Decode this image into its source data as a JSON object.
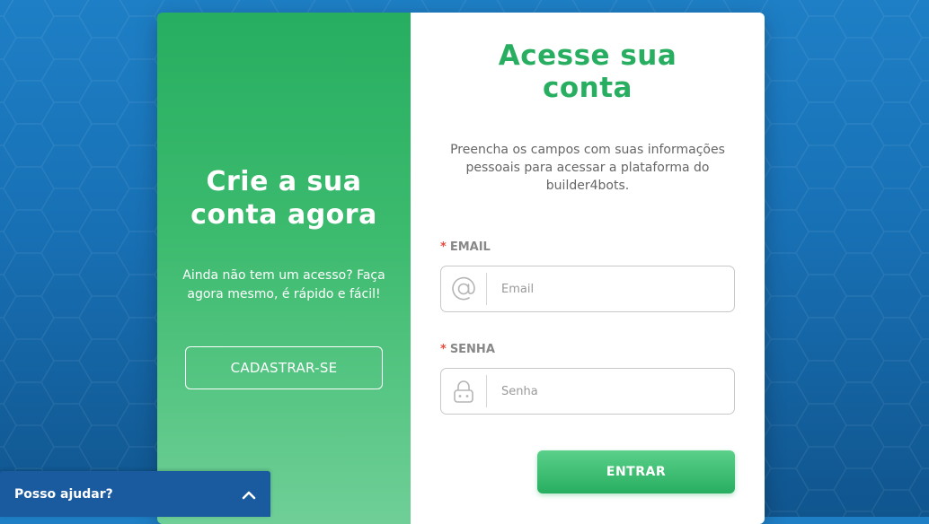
{
  "signup": {
    "title_line1": "Crie a sua",
    "title_line2": "conta agora",
    "description": "Ainda não tem um acesso? Faça agora mesmo, é rápido e fácil!",
    "button_label": "CADASTRAR-SE"
  },
  "login": {
    "title_line1": "Acesse sua",
    "title_line2": "conta",
    "description": "Preencha os campos com suas informações pessoais para acessar a plataforma do builder4bots.",
    "email_label": "EMAIL",
    "email_placeholder": "Email",
    "email_icon": "at-sign-icon",
    "password_label": "SENHA",
    "password_placeholder": "Senha",
    "password_icon": "lock-icon",
    "required_mark": "*",
    "submit_label": "ENTRAR"
  },
  "chat": {
    "label": "Posso ajudar?",
    "icon": "chevron-up-icon"
  },
  "colors": {
    "brand_green": "#27ae60",
    "background_blue": "#1870b4",
    "chat_blue": "#1a5a9e",
    "required_red": "#e74c3c"
  }
}
